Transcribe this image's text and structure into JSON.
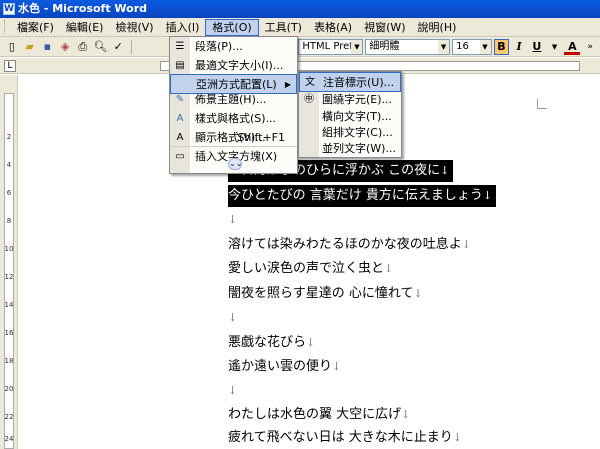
{
  "window": {
    "title": "水色 - Microsoft Word"
  },
  "menubar": {
    "items": [
      "檔案(F)",
      "編輯(E)",
      "檢視(V)",
      "插入(I)",
      "格式(O)",
      "工具(T)",
      "表格(A)",
      "視窗(W)",
      "說明(H)"
    ],
    "active_index": 4
  },
  "toolbar": {
    "style_value": "HTML Prefor",
    "font_value": "細明體",
    "size_value": "16",
    "bold_label": "B",
    "italic_label": "I",
    "underline_label": "U",
    "font_color_label": "A"
  },
  "ruler": {
    "tab_selector": "L"
  },
  "vruler": {
    "ticks": [
      "2",
      "4",
      "6",
      "8",
      "10",
      "12",
      "14",
      "16",
      "18",
      "20",
      "22",
      "24"
    ]
  },
  "format_menu": {
    "items": [
      {
        "label": "段落(P)...",
        "icon": "paragraph-icon"
      },
      {
        "label": "最適文字大小(I)...",
        "icon": "fit-text-icon"
      },
      {
        "label": "亞洲方式配置(L)",
        "icon": "",
        "has_submenu": true
      },
      {
        "label": "佈景主題(H)...",
        "icon": "theme-icon"
      },
      {
        "label": "樣式與格式(S)...",
        "icon": "styles-icon"
      },
      {
        "label": "顯示格式(V)...",
        "icon": "reveal-format-icon",
        "shortcut": "Shift+F1"
      },
      {
        "label": "插入文字方塊(X)",
        "icon": "textbox-icon"
      }
    ],
    "expand_label": "⌄⌄"
  },
  "asian_submenu": {
    "items": [
      {
        "label": "注音標示(U)...",
        "icon": "phonetic-guide-icon"
      },
      {
        "label": "圍繞字元(E)...",
        "icon": "enclose-char-icon"
      },
      {
        "label": "橫向文字(T)...",
        "icon": ""
      },
      {
        "label": "組排文字(C)...",
        "icon": ""
      },
      {
        "label": "並列文字(W)...",
        "icon": ""
      }
    ]
  },
  "document": {
    "lines": [
      {
        "text": "三日月が手のひらに浮かぶ この夜に",
        "selected": true
      },
      {
        "text": "今ひとたびの 言葉だけ 貴方に伝えましょう",
        "selected": true
      },
      {
        "text": "",
        "selected": false
      },
      {
        "text": "溶けては染みわたるほのかな夜の吐息よ",
        "selected": false
      },
      {
        "text": "愛しい涙色の声で泣く虫と",
        "selected": false
      },
      {
        "text": "闇夜を照らす星達の 心に憧れて",
        "selected": false
      },
      {
        "text": "",
        "selected": false
      },
      {
        "text": "悪戯な花びら",
        "selected": false
      },
      {
        "text": "遙か遠い雲の便り",
        "selected": false
      },
      {
        "text": "",
        "selected": false
      },
      {
        "text": "わたしは水色の翼 大空に広げ",
        "selected": false
      },
      {
        "text": "疲れて飛べない日は 大きな木に止まり",
        "selected": false
      }
    ],
    "para_mark": "↓"
  }
}
